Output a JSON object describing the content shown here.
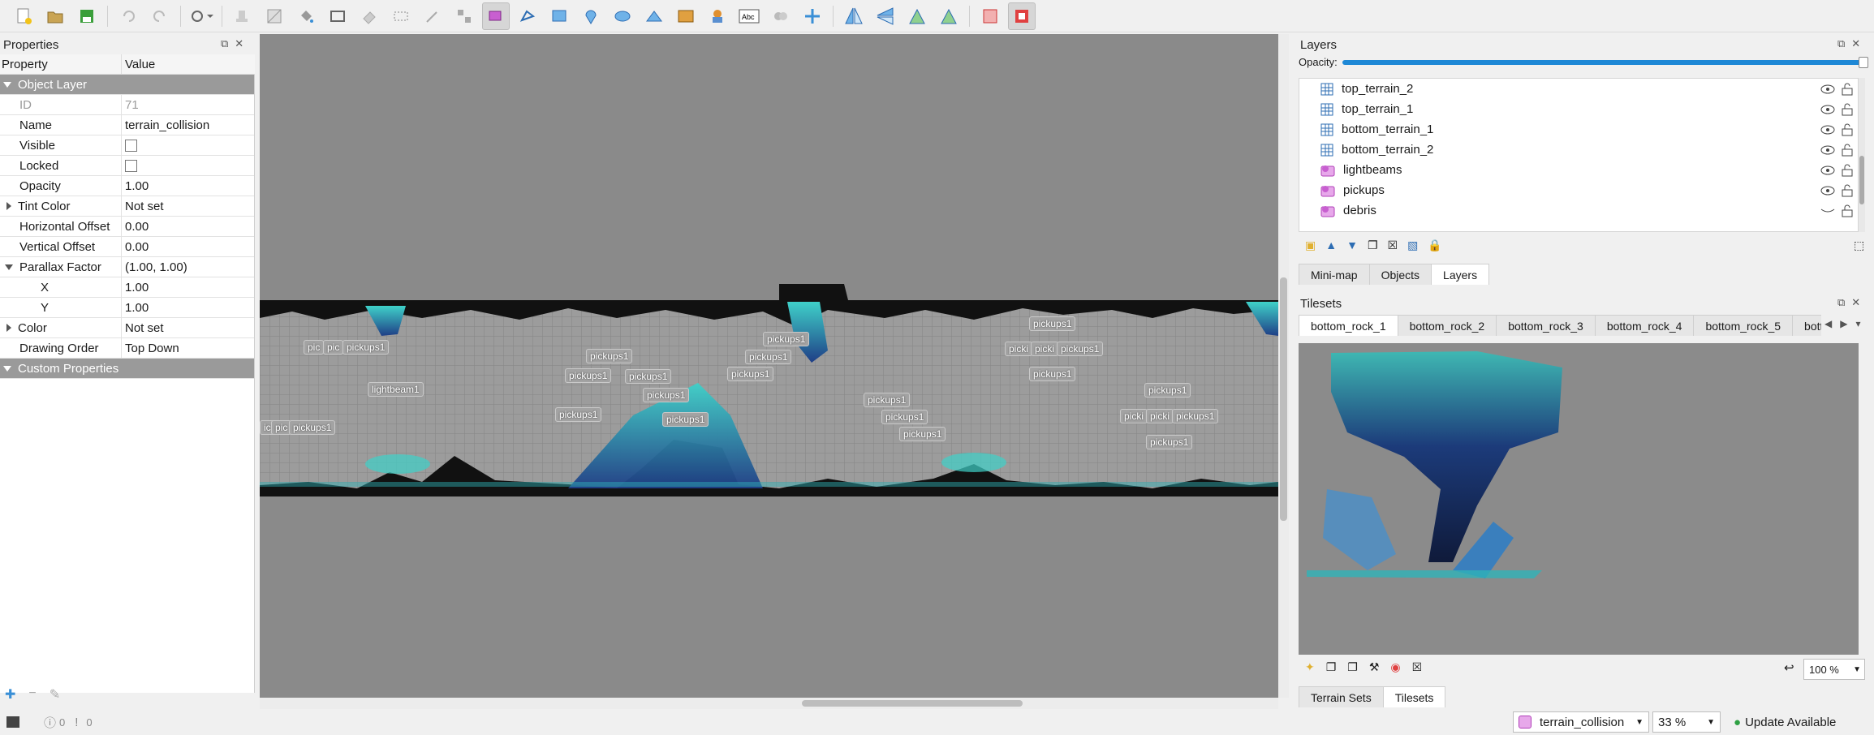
{
  "toolbar": {
    "tools": [
      "new-file-icon",
      "open-file-icon",
      "save-file-icon",
      "undo-icon",
      "redo-icon",
      "command-icon",
      "stamp-brush-icon",
      "terrain-brush-icon",
      "bucket-fill-icon",
      "shape-fill-icon",
      "eraser-icon",
      "rectangular-select-icon",
      "magic-wand-icon",
      "select-same-tile-icon",
      "select-objects-icon",
      "edit-polygons-icon",
      "insert-rectangle-icon",
      "insert-point-icon",
      "insert-ellipse-icon",
      "insert-polygon-icon",
      "insert-tile-icon",
      "insert-template-icon",
      "insert-text-icon",
      "replace-tile-icon",
      "world-tool-icon",
      "flip-horizontal-icon",
      "flip-vertical-icon",
      "rotate-left-icon",
      "rotate-right-icon",
      "random-mode-icon",
      "wang-fill-mode-icon"
    ]
  },
  "properties": {
    "title": "Properties",
    "col_property": "Property",
    "col_value": "Value",
    "group": "Object Layer",
    "rows": [
      {
        "key": "ID",
        "value": "71"
      },
      {
        "key": "Name",
        "value": "terrain_collision"
      },
      {
        "key": "Visible",
        "value": ""
      },
      {
        "key": "Locked",
        "value": ""
      },
      {
        "key": "Opacity",
        "value": "1.00"
      },
      {
        "key": "Tint Color",
        "value": "Not set"
      },
      {
        "key": "Horizontal Offset",
        "value": "0.00"
      },
      {
        "key": "Vertical Offset",
        "value": "0.00"
      },
      {
        "key": "Parallax Factor",
        "value": "(1.00, 1.00)"
      },
      {
        "key": "X",
        "value": "1.00"
      },
      {
        "key": "Y",
        "value": "1.00"
      },
      {
        "key": "Color",
        "value": "Not set"
      },
      {
        "key": "Drawing Order",
        "value": "Top Down"
      }
    ],
    "custom": "Custom Properties"
  },
  "map_labels": [
    "pic",
    "pic",
    "pickups1",
    "lightbeam1",
    "ic",
    "pic",
    "pickups1",
    "pickups1",
    "pickups1",
    "pickups1",
    "pickups1",
    "pickups1",
    "pickups1",
    "pickups1",
    "pickups1",
    "pickups1",
    "pickups1",
    "pickups1",
    "pickups1",
    "pickups1",
    "picki",
    "picki",
    "pickups1",
    "pickups1",
    "pickups1",
    "picki",
    "picki",
    "pickups1",
    "pickups1"
  ],
  "layers": {
    "title": "Layers",
    "opacity_label": "Opacity:",
    "items": [
      {
        "name": "top_terrain_2",
        "type": "tile"
      },
      {
        "name": "top_terrain_1",
        "type": "tile"
      },
      {
        "name": "bottom_terrain_1",
        "type": "tile"
      },
      {
        "name": "bottom_terrain_2",
        "type": "tile"
      },
      {
        "name": "lightbeams",
        "type": "object"
      },
      {
        "name": "pickups",
        "type": "object"
      },
      {
        "name": "debris",
        "type": "object"
      }
    ],
    "tabs": [
      "Mini-map",
      "Objects",
      "Layers"
    ]
  },
  "tilesets": {
    "title": "Tilesets",
    "tabs": [
      "bottom_rock_1",
      "bottom_rock_2",
      "bottom_rock_3",
      "bottom_rock_4",
      "bottom_rock_5",
      "bottom_"
    ],
    "zoom": "100 %",
    "bottom_tabs": [
      "Terrain Sets",
      "Tilesets"
    ]
  },
  "status": {
    "errors": "0",
    "warnings": "0",
    "layer": "terrain_collision",
    "zoom": "33 %",
    "update": "Update Available"
  },
  "colors": {
    "accent": "#1e88d6",
    "object_layer": "#c85fd0",
    "group_header": "#9a9a9a",
    "teal": "#2fb3b8"
  }
}
